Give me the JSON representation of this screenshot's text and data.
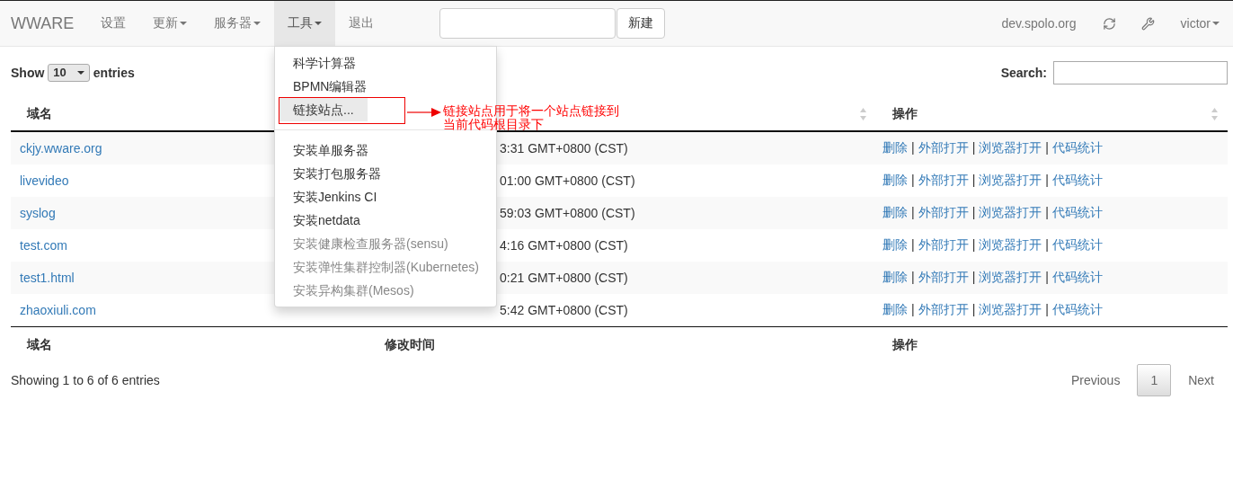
{
  "navbar": {
    "brand": "WWARE",
    "items": [
      {
        "label": "设置",
        "dropdown": false,
        "selected": false
      },
      {
        "label": "更新",
        "dropdown": true,
        "selected": false
      },
      {
        "label": "服务器",
        "dropdown": true,
        "selected": false
      },
      {
        "label": "工具",
        "dropdown": true,
        "selected": true
      },
      {
        "label": "退出",
        "dropdown": false,
        "selected": false
      }
    ],
    "new_button": "新建",
    "host": "dev.spolo.org",
    "user": "victor"
  },
  "tools_menu": {
    "groups": [
      {
        "items": [
          {
            "label": "科学计算器",
            "disabled": false,
            "highlighted": false
          },
          {
            "label": "BPMN编辑器",
            "disabled": false,
            "highlighted": false
          },
          {
            "label": "链接站点...",
            "disabled": false,
            "highlighted": true
          }
        ]
      },
      {
        "items": [
          {
            "label": "安装单服务器",
            "disabled": false,
            "highlighted": false
          },
          {
            "label": "安装打包服务器",
            "disabled": false,
            "highlighted": false
          },
          {
            "label": "安装Jenkins CI",
            "disabled": false,
            "highlighted": false
          },
          {
            "label": "安装netdata",
            "disabled": false,
            "highlighted": false
          },
          {
            "label": "安装健康检查服务器(sensu)",
            "disabled": true,
            "highlighted": false
          },
          {
            "label": "安装弹性集群控制器(Kubernetes)",
            "disabled": true,
            "highlighted": false
          },
          {
            "label": "安装异构集群(Mesos)",
            "disabled": true,
            "highlighted": false
          }
        ]
      }
    ]
  },
  "annotation": {
    "text": "链接站点用于将一个站点链接到当前代码根目录下"
  },
  "table": {
    "show_label": "Show",
    "length": "10",
    "entries_label": "entries",
    "search_label": "Search:",
    "header": [
      {
        "label": "域名"
      },
      {
        "sort_icon": true
      },
      {
        "label": "操作",
        "sort_icon": true
      }
    ],
    "separator": "|",
    "rows": [
      {
        "domain": "ckjy.wware.org",
        "time": "3:31 GMT+0800 (CST)",
        "actions": [
          "删除",
          "外部打开",
          "浏览器打开",
          "代码统计"
        ]
      },
      {
        "domain": "livevideo",
        "time": "01:00 GMT+0800 (CST)",
        "actions": [
          "删除",
          "外部打开",
          "浏览器打开",
          "代码统计"
        ]
      },
      {
        "domain": "syslog",
        "time": "59:03 GMT+0800 (CST)",
        "actions": [
          "删除",
          "外部打开",
          "浏览器打开",
          "代码统计"
        ]
      },
      {
        "domain": "test.com",
        "time": "4:16 GMT+0800 (CST)",
        "actions": [
          "删除",
          "外部打开",
          "浏览器打开",
          "代码统计"
        ]
      },
      {
        "domain": "test1.html",
        "time": "0:21 GMT+0800 (CST)",
        "actions": [
          "删除",
          "外部打开",
          "浏览器打开",
          "代码统计"
        ]
      },
      {
        "domain": "zhaoxiuli.com",
        "time": "5:42 GMT+0800 (CST)",
        "actions": [
          "删除",
          "外部打开",
          "浏览器打开",
          "代码统计"
        ]
      }
    ],
    "footer": [
      "域名",
      "修改时间",
      "操作"
    ],
    "info": "Showing 1 to 6 of 6 entries",
    "pagination": [
      {
        "label": "Previous",
        "selected": false
      },
      {
        "label": "1",
        "selected": true
      },
      {
        "label": "Next",
        "selected": false
      }
    ]
  }
}
